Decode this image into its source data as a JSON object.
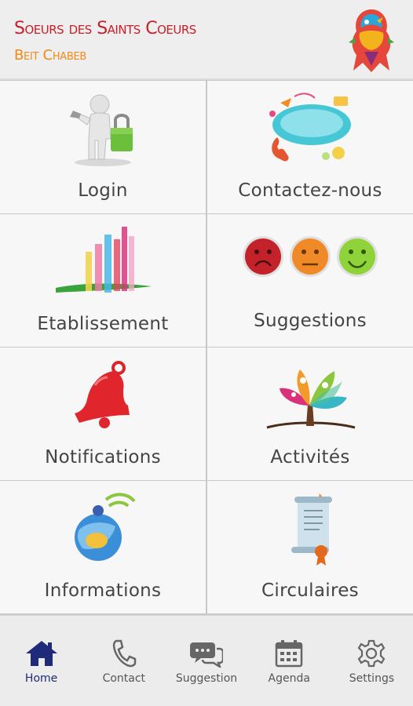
{
  "header": {
    "title": "Soeurs des Saints Coeurs",
    "subtitle": "Beit Chabeb",
    "title_color": "#c8202a",
    "subtitle_color": "#ef8a1b"
  },
  "tiles": [
    {
      "label": "Login",
      "icon": "padlock-person-icon"
    },
    {
      "label": "Contactez-nous",
      "icon": "speech-bubble-phone-icon"
    },
    {
      "label": "Etablissement",
      "icon": "building-bars-icon"
    },
    {
      "label": "Suggestions",
      "icon": "smiley-faces-icon"
    },
    {
      "label": "Notifications",
      "icon": "bell-icon"
    },
    {
      "label": "Activités",
      "icon": "activity-tree-icon"
    },
    {
      "label": "Informations",
      "icon": "globe-signal-icon"
    },
    {
      "label": "Circulaires",
      "icon": "scroll-icon"
    }
  ],
  "bottom_nav": {
    "items": [
      {
        "label": "Home",
        "icon": "home-icon",
        "active": true
      },
      {
        "label": "Contact",
        "icon": "phone-icon",
        "active": false
      },
      {
        "label": "Suggestion",
        "icon": "chat-bubbles-icon",
        "active": false
      },
      {
        "label": "Agenda",
        "icon": "calendar-icon",
        "active": false
      },
      {
        "label": "Settings",
        "icon": "gear-icon",
        "active": false
      }
    ],
    "active_color": "#1f2a7a",
    "inactive_color": "#555555"
  }
}
